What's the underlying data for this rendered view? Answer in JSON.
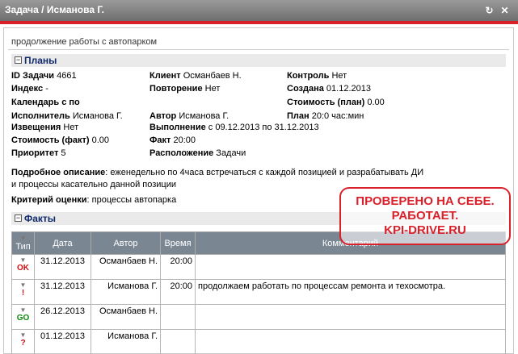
{
  "window": {
    "title": "Задача / Исманова Г."
  },
  "subtitle": "продолжение работы с автопарком",
  "plans": {
    "header": "Планы",
    "fields": {
      "id_label": "ID Задачи",
      "id_value": "4661",
      "index_label": "Индекс",
      "index_value": "-",
      "calendar_label": "Календарь с",
      "calendar_value": "по",
      "executor_label": "Исполнитель",
      "executor_value": "Исманова Г.",
      "notify_label": "Извещения",
      "notify_value": "Нет",
      "cost_fact_label": "Стоимость (факт)",
      "cost_fact_value": "0.00",
      "priority_label": "Приоритет",
      "priority_value": "5",
      "client_label": "Клиент",
      "client_value": "Османбаев Н.",
      "repeat_label": "Повторение",
      "repeat_value": "Нет",
      "author_label": "Автор",
      "author_value": "Исманова Г.",
      "exec_label": "Выполнение",
      "exec_value": "с 09.12.2013 по 31.12.2013",
      "fact_label": "Факт",
      "fact_value": "20:00",
      "location_label": "Расположение",
      "location_value": "Задачи",
      "control_label": "Контроль",
      "control_value": "Нет",
      "created_label": "Создана",
      "created_value": "01.12.2013",
      "cost_plan_label": "Стоимость (план)",
      "cost_plan_value": "0.00",
      "plan_label": "План",
      "plan_value": "20:0 час:мин"
    },
    "description_label": "Подробное описание",
    "description_line1": ": еженедельно по 4часа встречаться с каждой позицией и разрабатывать ДИ",
    "description_line2": "и процессы касательно данной позиции",
    "criteria_label": "Критерий оценки",
    "criteria_value": ": процессы автопарка"
  },
  "stamp": {
    "line1": "ПРОВЕРЕНО НА СЕБЕ.",
    "line2": "РАБОТАЕТ.",
    "line3": "KPI-DRIVE.RU"
  },
  "facts": {
    "header": "Факты",
    "columns": [
      "Тип",
      "Дата",
      "Автор",
      "Время",
      "Комментарий"
    ],
    "rows": [
      {
        "type": "OK",
        "type_color": "#d01010",
        "date": "31.12.2013",
        "author": "Османбаев Н.",
        "time": "20:00",
        "comment": ""
      },
      {
        "type": "!",
        "type_color": "#d01010",
        "date": "31.12.2013",
        "author": "Исманова Г.",
        "time": "20:00",
        "comment": "продолжаем работать по процессам ремонта и техосмотра."
      },
      {
        "type": "GO",
        "type_color": "#0a8a0a",
        "date": "26.12.2013",
        "author": "Османбаев Н.",
        "time": "",
        "comment": ""
      },
      {
        "type": "?",
        "type_color": "#d01010",
        "date": "01.12.2013",
        "author": "Исманова Г.",
        "time": "",
        "comment": ""
      }
    ]
  }
}
